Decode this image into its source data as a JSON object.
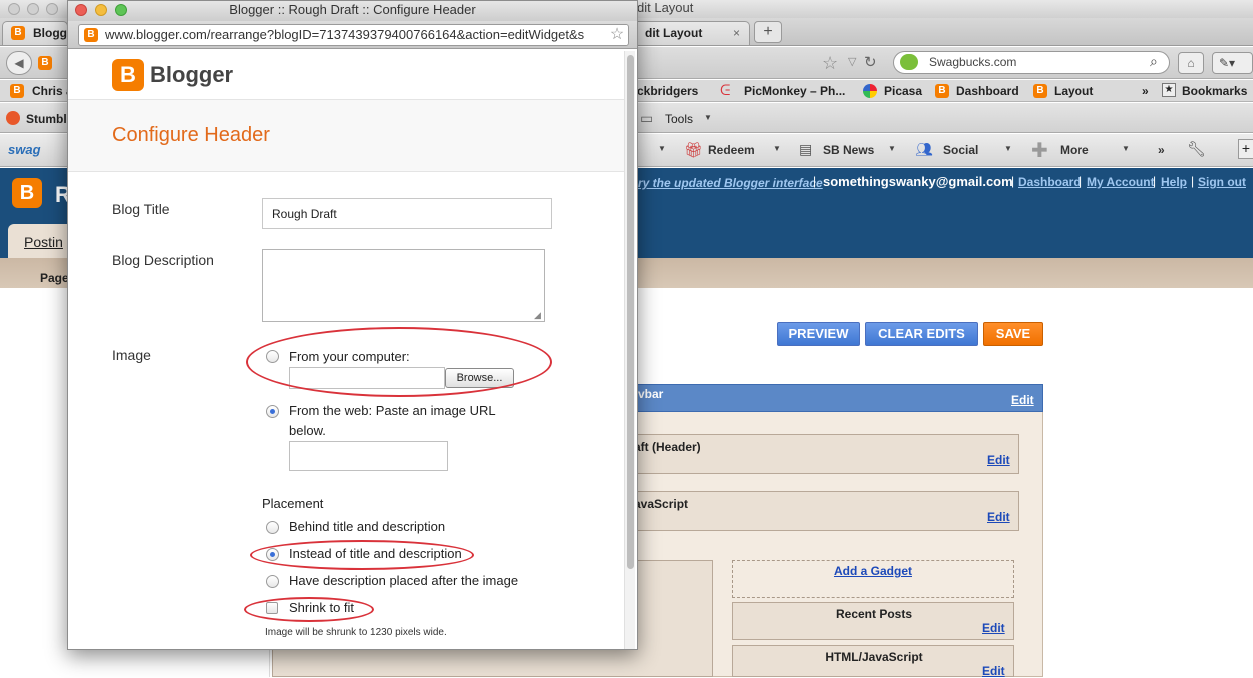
{
  "background_window": {
    "title": "dit Layout",
    "tabs": [
      {
        "label": "Blogg"
      },
      {
        "label": "dit Layout"
      }
    ],
    "new_tab": "+",
    "tab_close": "×",
    "search_value": "Swagbucks.com",
    "bookmarks": {
      "items": [
        "Chris a",
        "ckbridgers",
        "PicMonkey – Ph...",
        "Picasa",
        "Dashboard",
        "Layout"
      ],
      "overflow": "»",
      "bookmarks_menu": "Bookmarks"
    },
    "stumble": {
      "label": "Stumble",
      "tools": "Tools"
    },
    "swagbar": {
      "logo": "swag",
      "items": [
        "Redeem",
        "SB News",
        "Social",
        "More"
      ],
      "overflow": "»"
    },
    "blogger_header": {
      "letter": "R",
      "try_new": "ry the updated Blogger interface",
      "email": "somethingswanky@gmail.com",
      "links": [
        "Dashboard",
        "My Account",
        "Help",
        "Sign out"
      ],
      "separator": "|",
      "tab_posting": "Postin",
      "pages_tab": "Page"
    },
    "layout": {
      "buttons": {
        "preview": "PREVIEW",
        "clear": "CLEAR EDITS",
        "save": "SAVE"
      },
      "navbar_label": "vbar",
      "header_label": "aft (Header)",
      "js_label": "avaScript",
      "add_gadget": "Add a Gadget",
      "recent_posts": "Recent Posts",
      "html_js": "HTML/JavaScript",
      "edit": "Edit"
    }
  },
  "popup": {
    "title": "Blogger :: Rough Draft :: Configure Header",
    "url": "www.blogger.com/rearrange?blogID=7137439379400766164&action=editWidget&s",
    "logo_text": "Blogger",
    "heading": "Configure Header",
    "fields": {
      "blog_title_label": "Blog Title",
      "blog_title_value": "Rough Draft",
      "blog_description_label": "Blog Description",
      "blog_description_value": "",
      "image_label": "Image",
      "from_computer": "From your computer:",
      "browse": "Browse...",
      "from_web": "From the web: Paste an image URL",
      "from_web_2": "below.",
      "placement_label": "Placement",
      "placement_options": [
        {
          "label": "Behind title and description",
          "selected": false
        },
        {
          "label": "Instead of title and description",
          "selected": true
        },
        {
          "label": "Have description placed after the image",
          "selected": false
        }
      ],
      "shrink_label": "Shrink to fit",
      "shrink_checked": false,
      "shrink_note": "Image will be shrunk to 1230 pixels wide."
    },
    "image_source_selected": "web"
  },
  "colors": {
    "blogger_orange": "#f57d00",
    "heading_orange": "#e26a1b",
    "annotation_red": "#d9323a",
    "blogger_blue": "#1b4e7c"
  }
}
